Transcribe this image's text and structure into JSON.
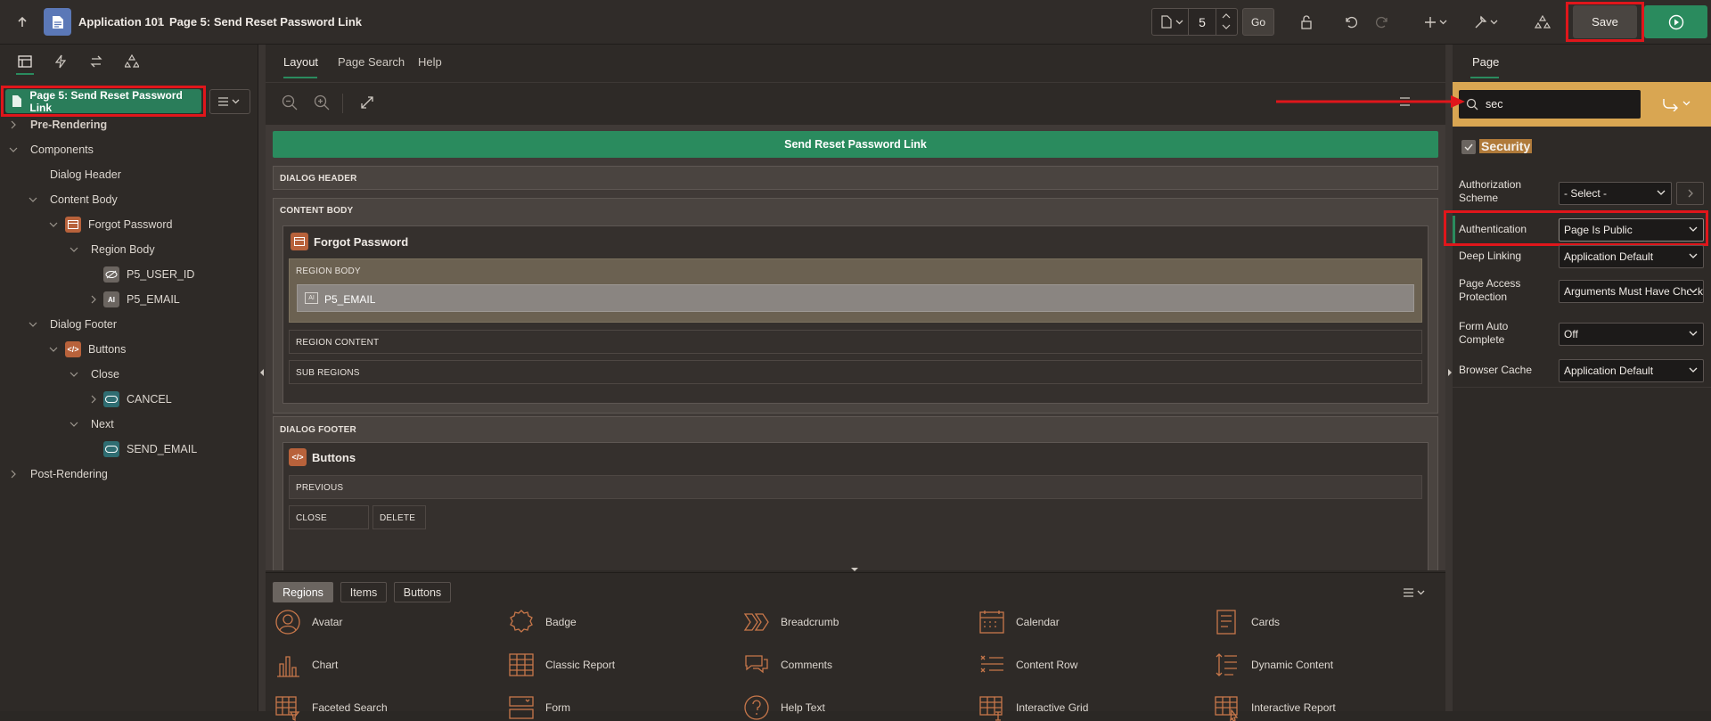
{
  "topbar": {
    "app_name": "Application 101",
    "separator": "\\",
    "page_name": "Page 5: Send Reset Password Link",
    "page_number": "5",
    "go_label": "Go",
    "save_label": "Save"
  },
  "left": {
    "page_header": "Page 5: Send Reset Password Link",
    "tree": {
      "pre_rendering": "Pre-Rendering",
      "components": "Components",
      "dialog_header": "Dialog Header",
      "content_body": "Content Body",
      "forgot_password": "Forgot Password",
      "region_body": "Region Body",
      "p5_user_id": "P5_USER_ID",
      "p5_email": "P5_EMAIL",
      "dialog_footer": "Dialog Footer",
      "buttons": "Buttons",
      "close": "Close",
      "cancel": "CANCEL",
      "next": "Next",
      "send_email": "SEND_EMAIL",
      "post_rendering": "Post-Rendering"
    }
  },
  "center": {
    "tabs": [
      "Layout",
      "Page Search",
      "Help"
    ],
    "banner": "Send Reset Password Link",
    "dialog_header": "DIALOG HEADER",
    "content_body": "CONTENT BODY",
    "forgot_password": "Forgot Password",
    "region_body": "REGION BODY",
    "p5_email": "P5_EMAIL",
    "region_content": "REGION CONTENT",
    "sub_regions": "SUB REGIONS",
    "dialog_footer": "DIALOG FOOTER",
    "buttons": "Buttons",
    "previous": "PREVIOUS",
    "close": "CLOSE",
    "delete": "DELETE",
    "gallery_tabs": [
      "Regions",
      "Items",
      "Buttons"
    ],
    "gallery": [
      [
        "Avatar",
        "Badge",
        "Breadcrumb",
        "Calendar",
        "Cards"
      ],
      [
        "Chart",
        "Classic Report",
        "Comments",
        "Content Row",
        "Dynamic Content"
      ],
      [
        "Faceted Search",
        "Form",
        "Help Text",
        "Interactive Grid",
        "Interactive Report"
      ]
    ]
  },
  "right": {
    "tab": "Page",
    "search_value": "sec",
    "group_title": "Security",
    "props": [
      {
        "label": "Authorization Scheme",
        "value": "- Select -"
      },
      {
        "label": "Authentication",
        "value": "Page Is Public"
      },
      {
        "label": "Deep Linking",
        "value": "Application Default"
      },
      {
        "label": "Page Access Protection",
        "value": "Arguments Must Have Checksum"
      },
      {
        "label": "Form Auto Complete",
        "value": "Off"
      },
      {
        "label": "Browser Cache",
        "value": "Application Default"
      }
    ]
  },
  "colors": {
    "accent_green": "#2a7d5a",
    "search_band": "#d9a652",
    "annotation_red": "#e0161b",
    "icon_orange": "#c8774a"
  }
}
